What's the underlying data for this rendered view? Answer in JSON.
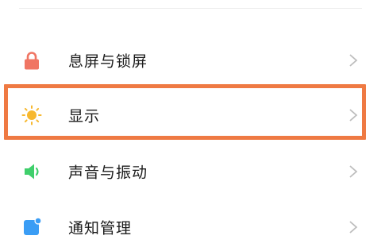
{
  "settings": {
    "items": [
      {
        "id": "lockscreen",
        "label": "息屏与锁屏",
        "icon": "lock-icon",
        "icon_color": "#f07563"
      },
      {
        "id": "display",
        "label": "显示",
        "icon": "sun-icon",
        "icon_color": "#f7b82f",
        "highlighted": true
      },
      {
        "id": "sound",
        "label": "声音与振动",
        "icon": "speaker-icon",
        "icon_color": "#3fcf6b"
      },
      {
        "id": "notifications",
        "label": "通知管理",
        "icon": "notification-icon",
        "icon_color": "#3a9df5"
      }
    ]
  },
  "theme": {
    "highlight_color": "#ef7a43",
    "chevron_color": "#bdbdbd"
  }
}
